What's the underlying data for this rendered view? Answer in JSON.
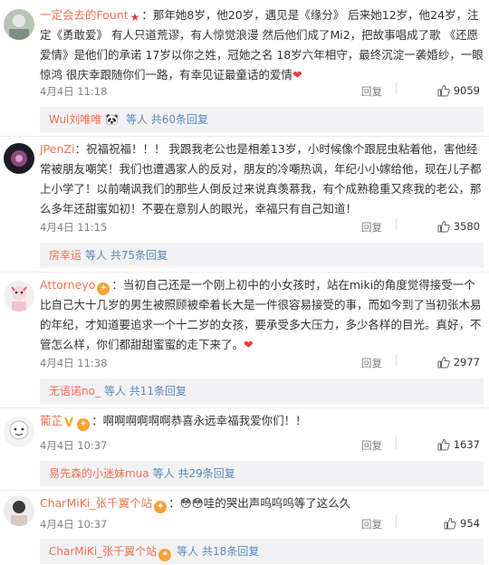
{
  "colors": {
    "username": "#eb7350",
    "text": "#333333",
    "meta": "#808080",
    "subbar_bg": "#f2f2f5",
    "link": "#5a8ab8"
  },
  "comments": [
    {
      "username": "一定会去的Fount",
      "text": "：那年她8岁，他20岁，遇见是《缘分》 后来她12岁，他24岁，注定《勇敢爱》 有人只道荒谬，有人惊觉浪漫 然后他们成了Mi2，把故事唱成了歌 《还愿爱情》是他们的承诺 17岁以你之姓，冠她之名 18岁六年相守，最终沉淀一袭婚纱，一眼惊鸿 很庆幸跟随你们一路，有幸见证最童话的爱情",
      "time": "4月4日 11:18",
      "reply": "回复",
      "likes": "9059",
      "sub_user": "Wul刘唯唯",
      "sub_text": "等人 共60条回复"
    },
    {
      "username": "JPenZi",
      "text": "：祝福祝福！！！ 我跟我老公也是相差13岁，小时候像个跟屁虫粘着他，害他经常被朋友嘲笑！我们也遭遇家人的反对，朋友的冷嘲热讽，年纪小小嫁给他，现在儿子都上小学了！以前嘲讽我们的那些人倒反过来说真羡慕我，有个成熟稳重又疼我的老公，那么多年还甜蜜如初！不要在意别人的眼光，幸福只有自己知道！",
      "time": "4月4日 11:15",
      "reply": "回复",
      "likes": "3580",
      "sub_user": "房幸运",
      "sub_text": "等人 共75条回复"
    },
    {
      "username": "Attorneyo",
      "text": "：当初自己还是一个刚上初中的小女孩时，站在miki的角度觉得接受一个比自己大十几岁的男生被照顾被牵着长大是一件很容易接受的事，而如今到了当初张木易的年纪，才知道要追求一个十二岁的女孩，要承受多大压力，多少各样的目光。真好，不管怎么样，你们都甜甜蜜蜜的走下来了。",
      "time": "4月4日 11:38",
      "reply": "回复",
      "likes": "2977",
      "sub_user": "无语诺no_",
      "sub_text": "等人 共11条回复"
    },
    {
      "username": "葡芷",
      "text": "：啊啊啊啊啊啊恭喜永远幸福我爱你们！！",
      "time": "4月4日 10:37",
      "reply": "回复",
      "likes": "1637",
      "sub_user": "易先森的小迷妹mua",
      "sub_text": "等人 共29条回复"
    },
    {
      "username": "CharMiKi_张千翼个站",
      "text": "：😳😳哇的哭出声呜呜呜等了这么久",
      "time": "4月4日 10:37",
      "reply": "回复",
      "likes": "954",
      "sub_user": "CharMiKi_张千翼个站",
      "sub_text": "等人 共18条回复"
    }
  ]
}
